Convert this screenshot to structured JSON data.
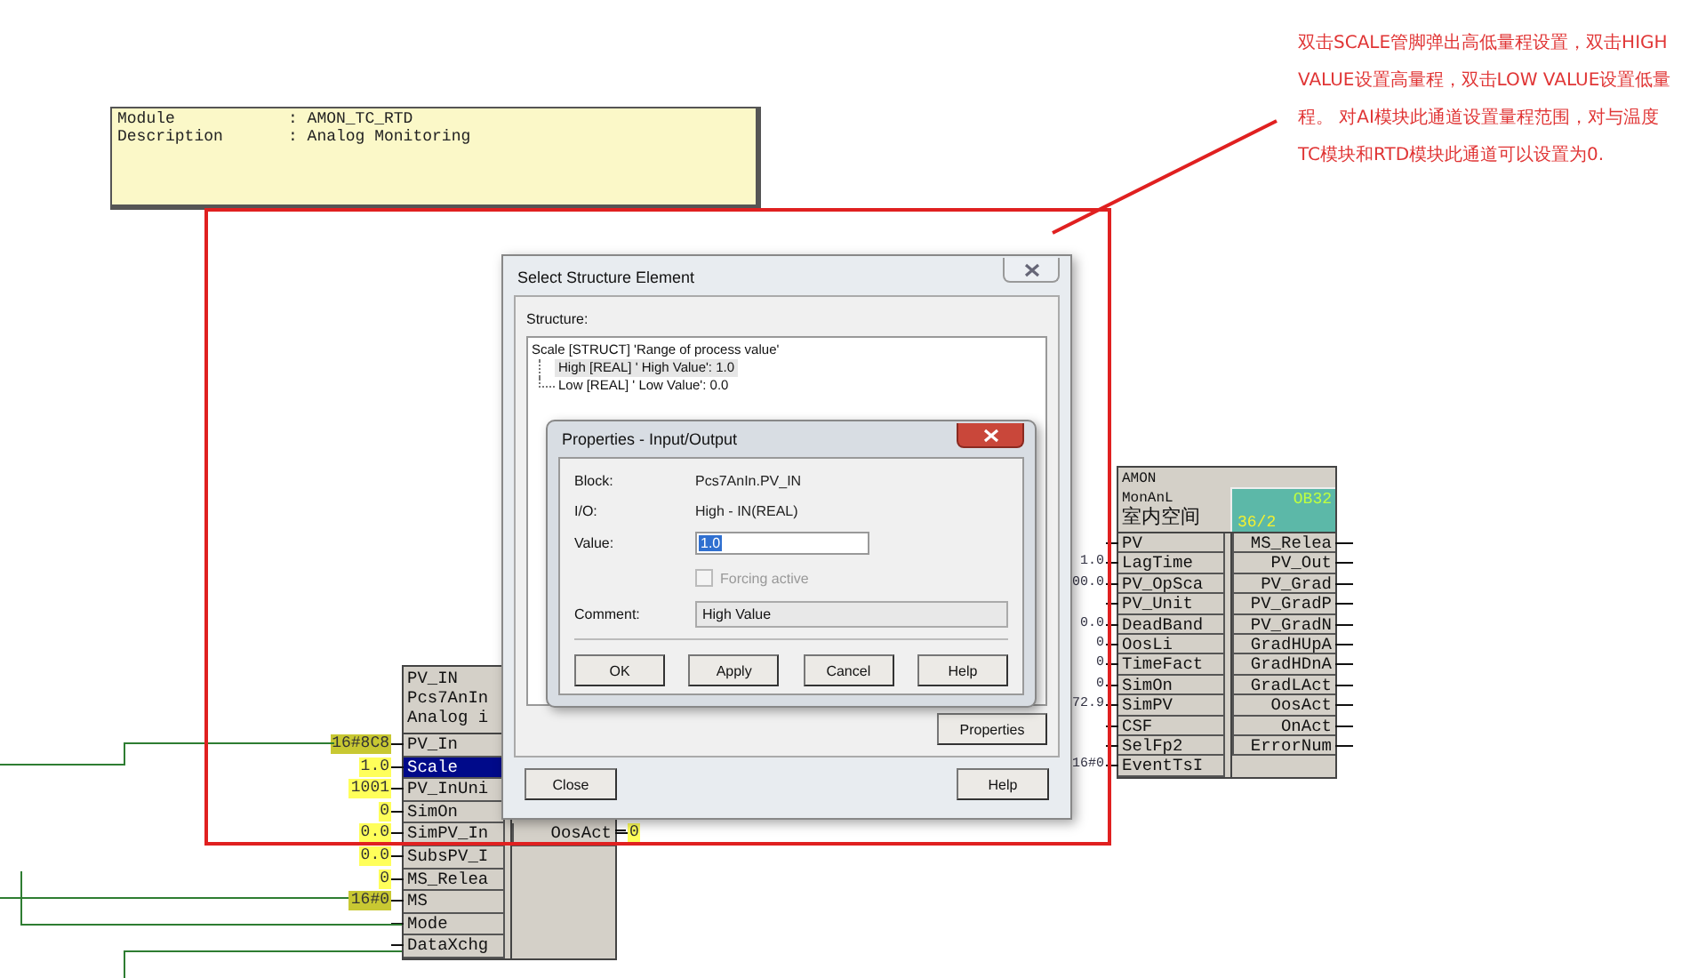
{
  "module_info": [
    {
      "label": "Module",
      "value": ": AMON_TC_RTD"
    },
    {
      "label": "Description",
      "value": ": Analog Monitoring"
    }
  ],
  "annotation": {
    "text": "双击SCALE管脚弹出高低量程设置，双击HIGH VALUE设置高量程，双击LOW VALUE设置低量程。   对AI模块此通道设置量程范围，对与温度TC模块和RTD模块此通道可以设置为0."
  },
  "blocks": [
    {
      "header": [
        "PV_IN",
        "Pcs7AnIn",
        "Analog i"
      ],
      "inputs": [
        {
          "name": "PV_In",
          "value": "16#8C8",
          "color": "#c8c832",
          "selected": false
        },
        {
          "name": "Scale",
          "value": "1.0",
          "color": "#ffff5a",
          "selected": true
        },
        {
          "name": "PV_InUni",
          "value": "1001",
          "color": "#ffff5a",
          "selected": false
        },
        {
          "name": "SimOn",
          "value": "0",
          "color": "#ffff5a",
          "selected": false
        },
        {
          "name": "SimPV_In",
          "value": "0.0",
          "color": "#ffff5a",
          "selected": false
        },
        {
          "name": "SubsPV_I",
          "value": "0.0",
          "color": "#ffff5a",
          "selected": false
        },
        {
          "name": "MS_Relea",
          "value": "0",
          "color": "#ffff5a",
          "selected": false
        },
        {
          "name": "MS",
          "value": "16#0",
          "color": "#c8c832",
          "selected": false
        },
        {
          "name": "Mode",
          "selected": false
        },
        {
          "name": "DataXchg",
          "selected": false
        }
      ],
      "outputs": [
        {
          "name": "OosAct",
          "value": "0",
          "color": "#ffff5a"
        }
      ]
    },
    {
      "header": [
        "AMON",
        "MonAnL",
        "室内空间"
      ],
      "task": {
        "name": "OB32",
        "order": "36/2"
      },
      "inputs": [
        {
          "name": "PV",
          "selected": false
        },
        {
          "name": "LagTime",
          "value": "1.0",
          "selected": false
        },
        {
          "name": "PV_OpSca",
          "value": "00.0",
          "selected": false
        },
        {
          "name": "PV_Unit",
          "selected": false
        },
        {
          "name": "DeadBand",
          "value": "0.0",
          "selected": false
        },
        {
          "name": "OosLi",
          "value": "0",
          "selected": false
        },
        {
          "name": "TimeFact",
          "value": "0",
          "selected": false
        },
        {
          "name": "SimOn",
          "value": "0",
          "selected": false
        },
        {
          "name": "SimPV",
          "value": "72.9",
          "selected": false
        },
        {
          "name": "CSF",
          "selected": false
        },
        {
          "name": "SelFp2",
          "selected": false
        },
        {
          "name": "EventTsI",
          "value": "16#0",
          "selected": false
        }
      ],
      "outputs": [
        {
          "name": "MS_Relea"
        },
        {
          "name": "PV_Out"
        },
        {
          "name": "PV_Grad"
        },
        {
          "name": "PV_GradP"
        },
        {
          "name": "PV_GradN"
        },
        {
          "name": "GradHUpA"
        },
        {
          "name": "GradHDnA"
        },
        {
          "name": "GradLAct"
        },
        {
          "name": "OosAct"
        },
        {
          "name": "OnAct"
        },
        {
          "name": "ErrorNum"
        }
      ]
    }
  ],
  "structure_dialog": {
    "title": "Select Structure Element",
    "structure_label": "Structure:",
    "tree": {
      "label": "Scale [STRUCT] 'Range of process value'",
      "children": [
        {
          "label": "High [REAL] ' High Value':  1.0",
          "selected": true
        },
        {
          "label": "Low [REAL] ' Low Value':  0.0",
          "selected": false
        }
      ]
    },
    "buttons": [
      {
        "kind": "properties",
        "label": "Properties"
      },
      {
        "kind": "close",
        "label": "Close"
      },
      {
        "kind": "help",
        "label": "Help"
      }
    ]
  },
  "properties_dialog": {
    "title": "Properties - Input/Output",
    "fields": [
      {
        "label": "Block:",
        "value": "Pcs7AnIn.PV_IN"
      },
      {
        "label": "I/O:",
        "value": "High  -  IN(REAL)"
      }
    ],
    "value_label": "Value:",
    "value": "1.0",
    "forcing": {
      "label": "Forcing active",
      "checked": false,
      "disabled": true
    },
    "comment_label": "Comment:",
    "comment": "High Value",
    "buttons": [
      "OK",
      "Apply",
      "Cancel",
      "Help"
    ]
  }
}
